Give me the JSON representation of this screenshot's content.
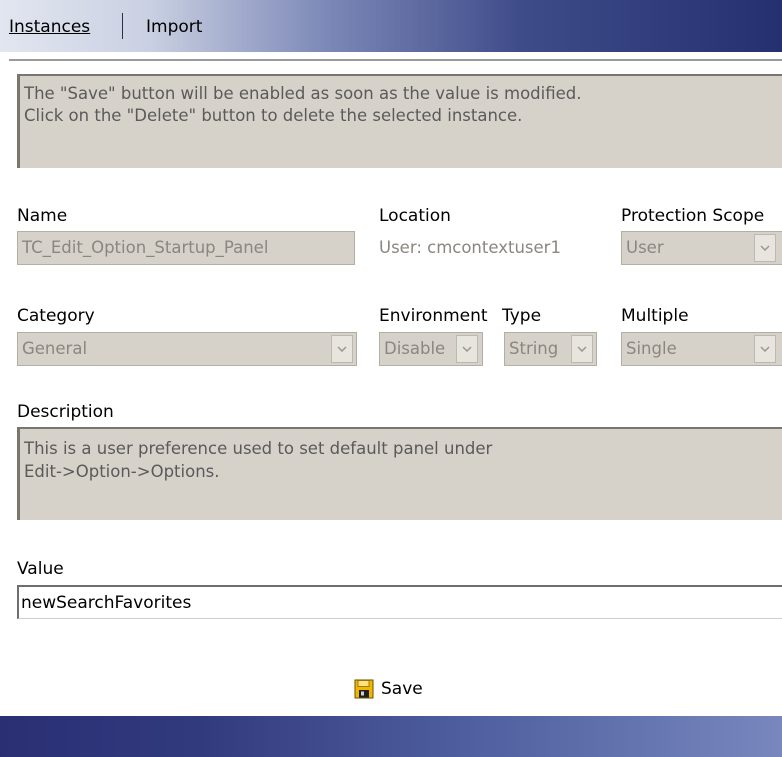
{
  "tabs": {
    "instances": "Instances",
    "import": "Import"
  },
  "info": {
    "line1": "The \"Save\" button will be enabled as soon as the value is modified.",
    "line2": "Click on the \"Delete\" button to delete the selected instance."
  },
  "fields": {
    "name": {
      "label": "Name",
      "value": "TC_Edit_Option_Startup_Panel"
    },
    "location": {
      "label": "Location",
      "value": "User: cmcontextuser1"
    },
    "protection_scope": {
      "label": "Protection Scope",
      "value": "User"
    },
    "category": {
      "label": "Category",
      "value": "General"
    },
    "environment": {
      "label": "Environment",
      "value": "Disable"
    },
    "type": {
      "label": "Type",
      "value": "String"
    },
    "multiple": {
      "label": "Multiple",
      "value": "Single"
    },
    "description": {
      "label": "Description",
      "line1": "This is a user preference used to set default panel under",
      "line2": "Edit->Option->Options."
    },
    "value": {
      "label": "Value",
      "value": "newSearchFavorites"
    }
  },
  "actions": {
    "save_label": "Save"
  },
  "icons": {
    "dropdown": "chevron-down-icon",
    "save": "floppy-disk-icon"
  },
  "colors": {
    "disabled_bg": "#d7d2c9",
    "disabled_text": "#8a8680",
    "header_dark": "#24306f",
    "save_icon": "#f2b500"
  }
}
